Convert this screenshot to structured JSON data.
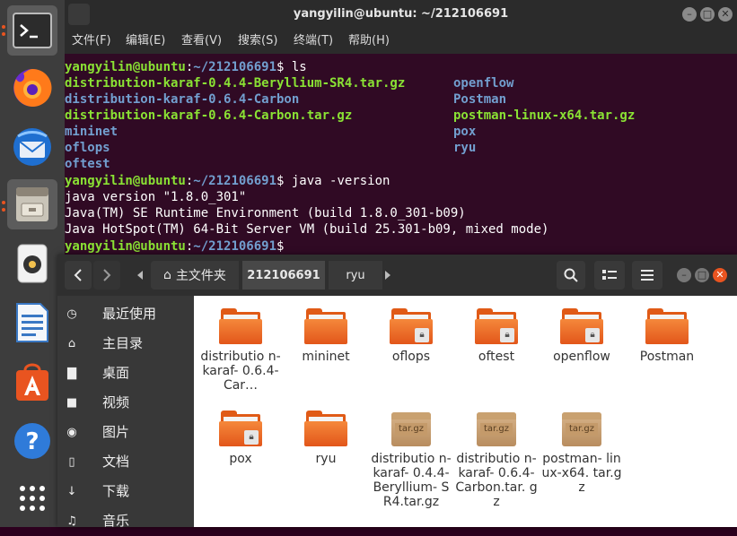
{
  "terminal": {
    "title": "yangyilin@ubuntu: ~/212106691",
    "menu": [
      "文件(F)",
      "编辑(E)",
      "查看(V)",
      "搜索(S)",
      "终端(T)",
      "帮助(H)"
    ],
    "window_controls": {
      "minimize": "–",
      "maximize": "□",
      "close": "✕"
    },
    "prompt_user": "yangyilin@ubuntu",
    "prompt_sep": ":",
    "prompt_path": "~/212106691",
    "prompt_end": "$ ",
    "cmd_ls": "ls",
    "ls_col1": [
      {
        "name": "distribution-karaf-0.4.4-Beryllium-SR4.tar.gz",
        "kind": "archive"
      },
      {
        "name": "distribution-karaf-0.6.4-Carbon",
        "kind": "dir"
      },
      {
        "name": "distribution-karaf-0.6.4-Carbon.tar.gz",
        "kind": "archive"
      },
      {
        "name": "mininet",
        "kind": "dir"
      },
      {
        "name": "oflops",
        "kind": "dir"
      },
      {
        "name": "oftest",
        "kind": "dir"
      }
    ],
    "ls_col2": [
      {
        "name": "openflow",
        "kind": "dir"
      },
      {
        "name": "Postman",
        "kind": "dir"
      },
      {
        "name": "postman-linux-x64.tar.gz",
        "kind": "archive"
      },
      {
        "name": "pox",
        "kind": "dir"
      },
      {
        "name": "ryu",
        "kind": "dir"
      }
    ],
    "cmd_java": "java -version",
    "java_output": [
      "java version \"1.8.0_301\"",
      "Java(TM) SE Runtime Environment (build 1.8.0_301-b09)",
      "Java HotSpot(TM) 64-Bit Server VM (build 25.301-b09, mixed mode)"
    ]
  },
  "filemanager": {
    "breadcrumbs": {
      "home": "主文件夹",
      "current": "212106691",
      "child": "ryu"
    },
    "sidebar": [
      {
        "label": "最近使用",
        "icon": "clock-icon",
        "glyph": "◷"
      },
      {
        "label": "主目录",
        "icon": "home-icon",
        "glyph": "⌂"
      },
      {
        "label": "桌面",
        "icon": "desktop-folder-icon",
        "glyph": "▇"
      },
      {
        "label": "视频",
        "icon": "video-icon",
        "glyph": "■"
      },
      {
        "label": "图片",
        "icon": "camera-icon",
        "glyph": "◉"
      },
      {
        "label": "文档",
        "icon": "document-icon",
        "glyph": "▯"
      },
      {
        "label": "下载",
        "icon": "download-icon",
        "glyph": "↓"
      },
      {
        "label": "音乐",
        "icon": "music-icon",
        "glyph": "♫"
      }
    ],
    "items": [
      {
        "name": "distributio n-karaf- 0.6.4-Car…",
        "type": "folder",
        "locked": false
      },
      {
        "name": "mininet",
        "type": "folder",
        "locked": false
      },
      {
        "name": "oflops",
        "type": "folder",
        "locked": true
      },
      {
        "name": "oftest",
        "type": "folder",
        "locked": true
      },
      {
        "name": "openflow",
        "type": "folder",
        "locked": true
      },
      {
        "name": "Postman",
        "type": "folder",
        "locked": false
      },
      {
        "name": "pox",
        "type": "folder",
        "locked": true
      },
      {
        "name": "ryu",
        "type": "folder",
        "locked": false
      },
      {
        "name": "distributio n-karaf- 0.4.4- Beryllium- SR4.tar.gz",
        "type": "archive",
        "locked": false
      },
      {
        "name": "distributio n-karaf- 0.6.4- Carbon.tar. gz",
        "type": "archive",
        "locked": false
      },
      {
        "name": "postman- linux-x64. tar.gz",
        "type": "archive",
        "locked": false
      }
    ],
    "archive_label": "tar.gz"
  },
  "dock": [
    "terminal-icon",
    "firefox-icon",
    "thunderbird-icon",
    "files-icon",
    "rhythmbox-icon",
    "writer-icon",
    "software-icon",
    "help-icon",
    "app-grid-icon"
  ],
  "help_glyph": "?",
  "colors": {
    "terminal_bg": "#300a24",
    "prompt_green": "#8ae234",
    "dir_blue": "#729fcf",
    "folder_orange": "#e95420",
    "titlebar": "#2b2b2b"
  }
}
